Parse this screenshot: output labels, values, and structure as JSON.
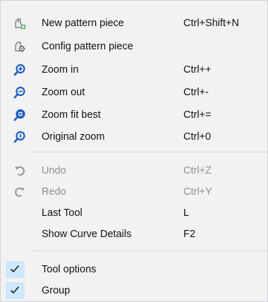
{
  "menu": {
    "items": [
      {
        "label": "New pattern piece",
        "shortcut": "Ctrl+Shift+N",
        "icon": "new-pattern-piece-icon"
      },
      {
        "label": "Config pattern piece",
        "shortcut": "",
        "icon": "config-pattern-piece-icon"
      },
      {
        "label": "Zoom in",
        "shortcut": "Ctrl++",
        "icon": "zoom-in-icon"
      },
      {
        "label": "Zoom out",
        "shortcut": "Ctrl+-",
        "icon": "zoom-out-icon"
      },
      {
        "label": "Zoom fit best",
        "shortcut": "Ctrl+=",
        "icon": "zoom-fit-best-icon"
      },
      {
        "label": "Original zoom",
        "shortcut": "Ctrl+0",
        "icon": "original-zoom-icon"
      },
      {
        "label": "Undo",
        "shortcut": "Ctrl+Z",
        "icon": "undo-icon",
        "disabled": true
      },
      {
        "label": "Redo",
        "shortcut": "Ctrl+Y",
        "icon": "redo-icon",
        "disabled": true
      },
      {
        "label": "Last Tool",
        "shortcut": "L",
        "icon": ""
      },
      {
        "label": "Show Curve Details",
        "shortcut": "F2",
        "icon": ""
      },
      {
        "label": "Tool options",
        "shortcut": "",
        "icon": "checkmark-icon",
        "checked": true
      },
      {
        "label": "Group",
        "shortcut": "",
        "icon": "checkmark-icon",
        "checked": true
      }
    ]
  },
  "colors": {
    "menu_bg": "#f2f2f2",
    "zoom_icon_blue": "#1f5fbf",
    "check_bg": "#cde8ff",
    "disabled_text": "#8f8f8f"
  }
}
